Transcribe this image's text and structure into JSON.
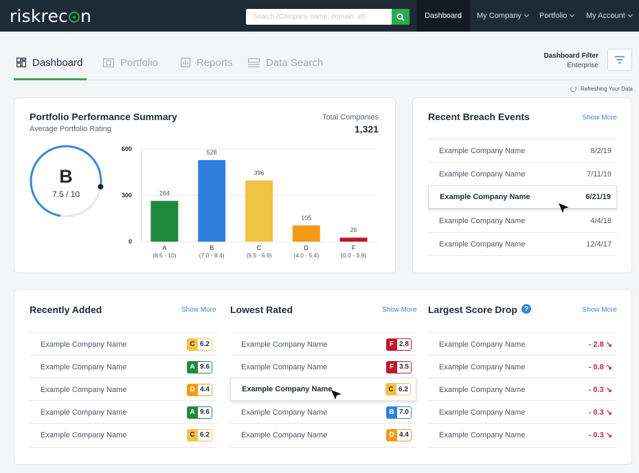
{
  "topbar": {
    "logo": "riskrecon",
    "search_placeholder": "Search (Company name, domain, id)",
    "nav": [
      {
        "label": "Dashboard",
        "active": true
      },
      {
        "label": "My Company"
      },
      {
        "label": "Portfolio"
      },
      {
        "label": "My Account"
      }
    ]
  },
  "tabs": [
    {
      "label": "Dashboard",
      "icon": "grid-icon",
      "active": true
    },
    {
      "label": "Portfolio",
      "icon": "portfolio-icon"
    },
    {
      "label": "Reports",
      "icon": "report-icon"
    },
    {
      "label": "Data Search",
      "icon": "data-search-icon"
    }
  ],
  "filter": {
    "title": "Dashboard Filter",
    "value": "Enterprise",
    "icon": "filter-icon"
  },
  "refresh_text": "Refreshing Your Data",
  "performance": {
    "title": "Portfolio Performance Summary",
    "subtitle": "Average Portfolio Rating",
    "total_label": "Total Companies",
    "total_value": "1,321",
    "grade": "B",
    "score": "7.5 / 10",
    "score_value": 7.5
  },
  "chart_data": {
    "type": "bar",
    "categories": [
      "A",
      "B",
      "C",
      "D",
      "F"
    ],
    "category_ranges": [
      "(8.5 - 10)",
      "(7.0 - 8.4)",
      "(5.5 - 6.9)",
      "(4.0 - 5.4)",
      "(0.0 - 3.9)"
    ],
    "values": [
      264,
      528,
      396,
      105,
      26
    ],
    "colors": [
      "#1f8a3c",
      "#2f7fe0",
      "#f1c343",
      "#f39a16",
      "#c0182a"
    ],
    "yticks": [
      0,
      300,
      600
    ],
    "ylim": [
      0,
      600
    ],
    "grid": true
  },
  "breach": {
    "title": "Recent Breach Events",
    "show_more": "Show More",
    "rows": [
      {
        "name": "Example Company Name",
        "date": "8/2/19"
      },
      {
        "name": "Example Company Name",
        "date": "7/11/19"
      },
      {
        "name": "Example Company Name",
        "date": "6/21/19",
        "highlight": true
      },
      {
        "name": "Example Company Name",
        "date": "4/4/18"
      },
      {
        "name": "Example Company Name",
        "date": "12/4/17"
      }
    ]
  },
  "recently_added": {
    "title": "Recently Added",
    "show_more": "Show More",
    "rows": [
      {
        "name": "Example Company Name",
        "grade": "C",
        "score": "6.2"
      },
      {
        "name": "Example Company Name",
        "grade": "A",
        "score": "9.6"
      },
      {
        "name": "Example Company Name",
        "grade": "D",
        "score": "4.4"
      },
      {
        "name": "Example Company Name",
        "grade": "A",
        "score": "9.6"
      },
      {
        "name": "Example Company Name",
        "grade": "C",
        "score": "6.2"
      }
    ]
  },
  "lowest_rated": {
    "title": "Lowest Rated",
    "show_more": "Show More",
    "rows": [
      {
        "name": "Example Company Name",
        "grade": "F",
        "score": "2.8"
      },
      {
        "name": "Example Company Name",
        "grade": "F",
        "score": "3.5"
      },
      {
        "name": "Example Company Name",
        "grade": "C",
        "score": "6.2",
        "highlight": true
      },
      {
        "name": "Example Company Name",
        "grade": "B",
        "score": "7.0"
      },
      {
        "name": "Example Company Name",
        "grade": "D",
        "score": "4.4"
      }
    ]
  },
  "largest_drop": {
    "title": "Largest Score Drop",
    "help_icon": "help-icon",
    "show_more": "Show More",
    "rows": [
      {
        "name": "Example Company Name",
        "drop": "- 2.8"
      },
      {
        "name": "Example Company Name",
        "drop": "- 0.8"
      },
      {
        "name": "Example Company Name",
        "drop": "- 0.3"
      },
      {
        "name": "Example Company Name",
        "drop": "- 0.3"
      },
      {
        "name": "Example Company Name",
        "drop": "- 0.3"
      }
    ]
  },
  "grade_colors": {
    "A": "#1f8a3c",
    "B": "#2f7fe0",
    "C": "#f1c343",
    "D": "#f39a16",
    "F": "#c0182a"
  },
  "grade_text_colors": {
    "A": "#ffffff",
    "B": "#ffffff",
    "C": "#1f2a37",
    "D": "#ffffff",
    "F": "#ffffff"
  }
}
